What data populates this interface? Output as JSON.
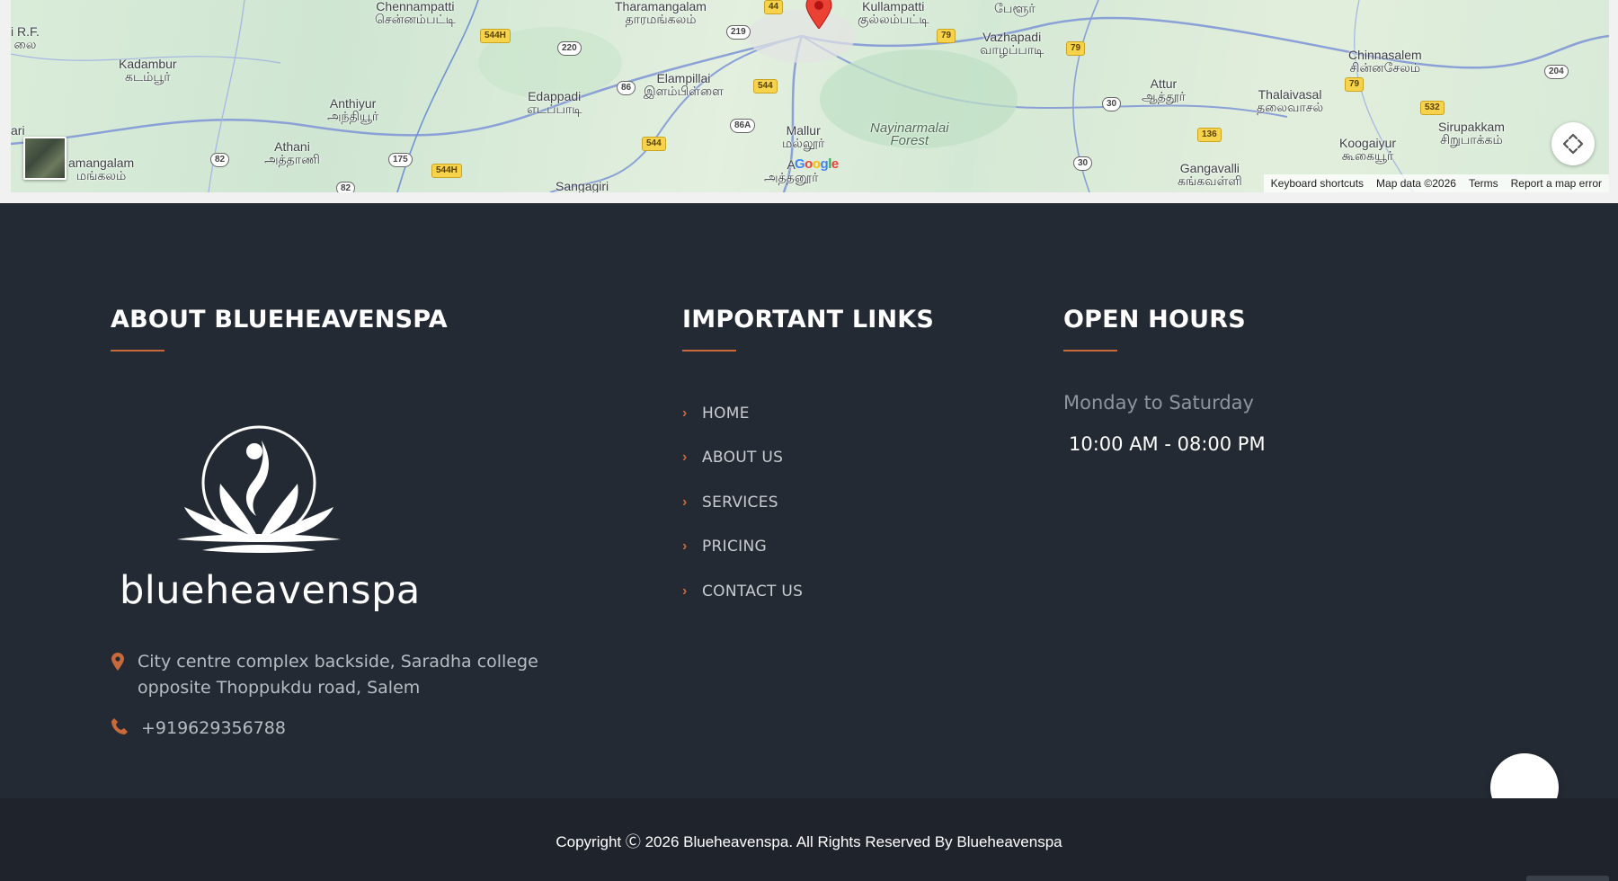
{
  "map": {
    "labels": [
      {
        "text": "Chennampatti\nசென்னம்பட்டி"
      },
      {
        "text": "Tharamangalam\nதாரமங்கலம்"
      },
      {
        "text": "Kullampatti\nகுல்லம்பட்டி"
      },
      {
        "text": "பேளூர்"
      },
      {
        "text": "Vazhapadi\nவாழப்பாடி"
      },
      {
        "text": "i R.F.\nலை"
      },
      {
        "text": "Kadambur\nகடம்பூர்"
      },
      {
        "text": "Anthiyur\nஅந்தியூர்"
      },
      {
        "text": "Edappadi\nஎடப்பாடி"
      },
      {
        "text": "Elampillai\nஇளம்பிள்ளை"
      },
      {
        "text": "Chinnasalem\nசின்னசேலம்"
      },
      {
        "text": "Attur\nஆத்தூர்"
      },
      {
        "text": "Thalaivasal\nதலைவாசல்"
      },
      {
        "text": "ari"
      },
      {
        "text": "Athani\nஅத்தாணி"
      },
      {
        "text": "amangalam\nமங்கலம்"
      },
      {
        "text": "Mallur\nமல்லூர்"
      },
      {
        "text": "Koogaiyur\nகூகையூர்"
      },
      {
        "text": "Sirupakkam\nசிறுபாக்கம்"
      },
      {
        "text": "Gangavalli\nகங்கவள்ளி"
      },
      {
        "text": "Sangagiri"
      },
      {
        "text": "A\nஅத்தனூர்"
      }
    ],
    "forest_label": "Nayinarmalai\nForest",
    "shields": [
      "44",
      "544H",
      "220",
      "219",
      "79",
      "79",
      "204",
      "86",
      "544",
      "79",
      "86A",
      "30",
      "532",
      "136",
      "544",
      "82",
      "175",
      "544H",
      "30",
      "82"
    ],
    "google": "Google",
    "footer_links": [
      "Keyboard shortcuts",
      "Map data ©2026",
      "Terms",
      "Report a map error"
    ],
    "accent_color": "#ea4335"
  },
  "about": {
    "title": "ABOUT BLUEHEAVENSPA",
    "logo_text": "blueheavenspa",
    "address": "City centre complex backside, Saradha college\nopposite Thoppukdu road, Salem",
    "phone": "+919629356788"
  },
  "links": {
    "title": "IMPORTANT LINKS",
    "items": [
      {
        "label": "HOME"
      },
      {
        "label": "ABOUT US"
      },
      {
        "label": "SERVICES"
      },
      {
        "label": "PRICING"
      },
      {
        "label": "CONTACT US"
      }
    ]
  },
  "hours": {
    "title": "OPEN HOURS",
    "days": "Monday to Saturday",
    "time": "10:00 AM - 08:00 PM"
  },
  "copyright": "Copyright Ⓒ 2026 Blueheavenspa. All Rights Reserved By Blueheavenspa",
  "colors": {
    "background": "#242a33",
    "accent": "#c7693a",
    "copyright_bar": "#1f242c"
  }
}
